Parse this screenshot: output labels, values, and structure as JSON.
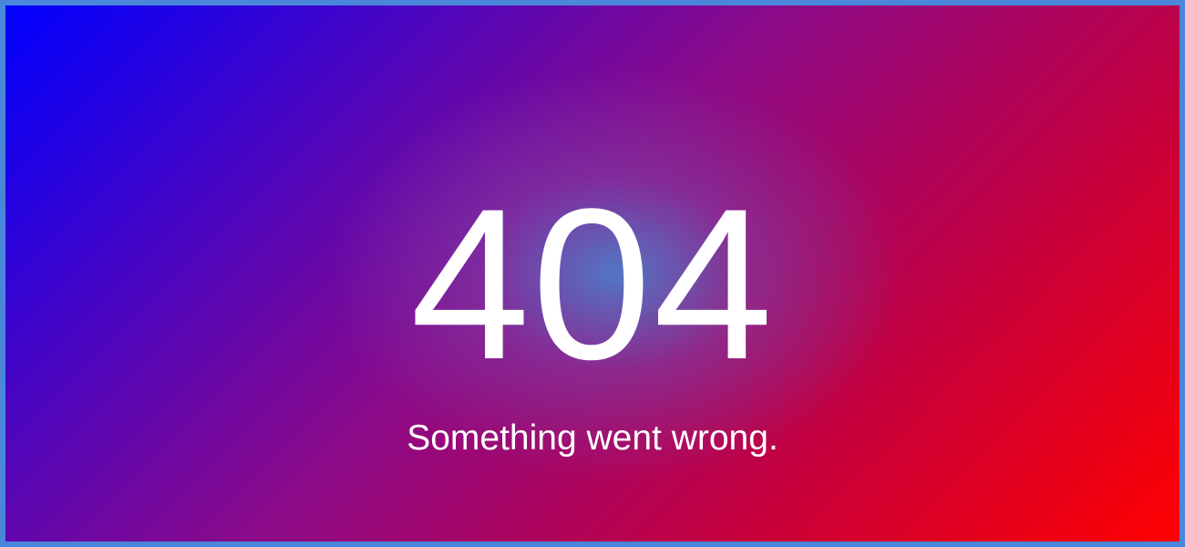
{
  "error": {
    "code": "404",
    "message": "Something went wrong."
  },
  "colors": {
    "gradient_start": "#0000ff",
    "gradient_middle": "#8a0a8a",
    "gradient_end": "#ff0000",
    "center_glow": "#4f7cc8",
    "border": "#4a86d9",
    "text": "#ffffff"
  }
}
